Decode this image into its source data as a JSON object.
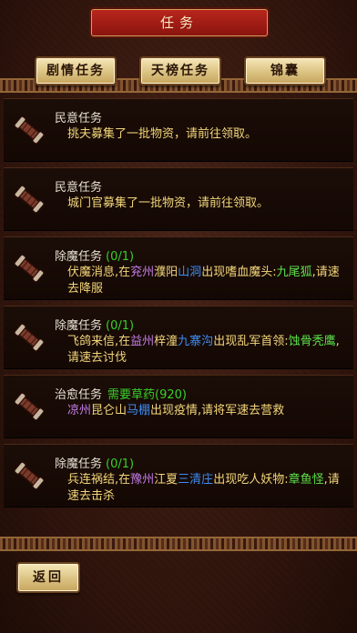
{
  "header": {
    "title": "任务"
  },
  "tabs": [
    {
      "label": "剧情任务"
    },
    {
      "label": "天榜任务"
    },
    {
      "label": "锦囊"
    }
  ],
  "tasks": [
    {
      "title": "民意任务",
      "progress": "",
      "segments": [
        {
          "text": "挑夫募集了一批物资，请前往领取。",
          "color": "y"
        }
      ]
    },
    {
      "title": "民意任务",
      "progress": "",
      "segments": [
        {
          "text": "城门官募集了一批物资，请前往领取。",
          "color": "y"
        }
      ]
    },
    {
      "title": "除魔任务",
      "progress": "(0/1)",
      "segments": [
        {
          "text": "伏魔消息,在",
          "color": "y"
        },
        {
          "text": "兖州",
          "color": "p"
        },
        {
          "text": "濮阳",
          "color": "y"
        },
        {
          "text": "山洞",
          "color": "b"
        },
        {
          "text": "出现嗜血魔头:",
          "color": "y"
        },
        {
          "text": "九尾狐",
          "color": "g"
        },
        {
          "text": ",请速去降服",
          "color": "y"
        }
      ]
    },
    {
      "title": "除魔任务",
      "progress": "(0/1)",
      "segments": [
        {
          "text": "飞鸽来信,在",
          "color": "y"
        },
        {
          "text": "益州",
          "color": "p"
        },
        {
          "text": "梓潼",
          "color": "y"
        },
        {
          "text": "九寨沟",
          "color": "b"
        },
        {
          "text": "出现乱军首领:",
          "color": "y"
        },
        {
          "text": "蚀骨秃鹰",
          "color": "g"
        },
        {
          "text": ",请速去讨伐",
          "color": "y"
        }
      ]
    },
    {
      "title": "治愈任务",
      "progress": "",
      "need": "需要草药(920)",
      "segments": [
        {
          "text": "凉州",
          "color": "p"
        },
        {
          "text": "昆仑山",
          "color": "y"
        },
        {
          "text": "马棚",
          "color": "b"
        },
        {
          "text": "出现疫情,请将军速去营救",
          "color": "y"
        }
      ]
    },
    {
      "title": "除魔任务",
      "progress": "(0/1)",
      "segments": [
        {
          "text": "兵连祸结,在",
          "color": "y"
        },
        {
          "text": "豫州",
          "color": "p"
        },
        {
          "text": "江夏",
          "color": "y"
        },
        {
          "text": "三清庄",
          "color": "b"
        },
        {
          "text": "出现吃人妖物:",
          "color": "y"
        },
        {
          "text": "章鱼怪",
          "color": "g"
        },
        {
          "text": ",请速去击杀",
          "color": "y"
        }
      ]
    }
  ],
  "footer": {
    "back_label": "返回"
  },
  "icons": {
    "task": "scroll-icon"
  }
}
